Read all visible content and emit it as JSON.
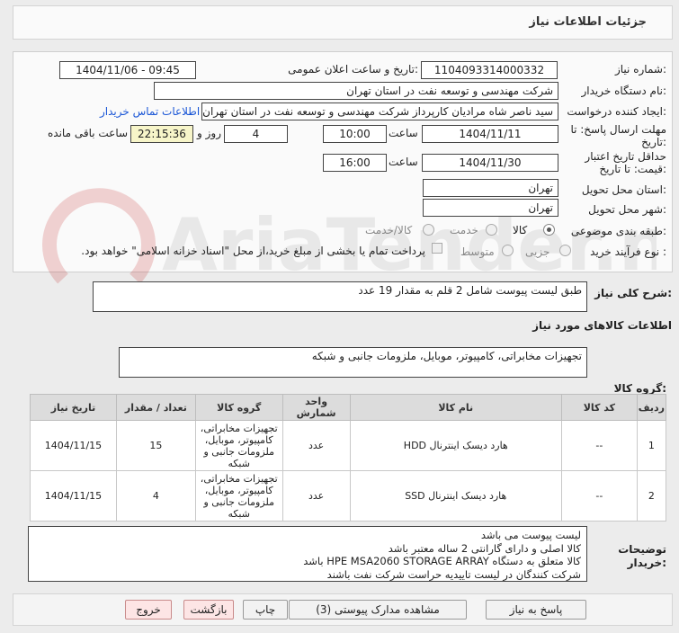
{
  "header": {
    "title": "جزئیات اطلاعات نیاز"
  },
  "form": {
    "need_number_label": "شماره نیاز:",
    "need_number": "1104093314000332",
    "announce_label": "تاریخ و ساعت اعلان عمومی:",
    "announce_value": "1404/11/06 - 09:45",
    "buyer_org_label": "نام دستگاه خریدار:",
    "buyer_org": "شرکت مهندسی و توسعه نفت در استان تهران",
    "creator_label": "ایجاد کننده درخواست:",
    "creator": "سید ناصر شاه مرادیان کارپرداز شرکت مهندسی و توسعه نفت در استان تهران",
    "contact_link": "اطلاعات تماس خریدار",
    "deadline_label_1": "مهلت ارسال پاسخ: تا",
    "deadline_label_2": "تاریخ:",
    "deadline_date": "1404/11/11",
    "time_label": "ساعت",
    "deadline_time": "10:00",
    "days_value": "4",
    "days_label": "روز و",
    "remaining_time": "22:15:36",
    "remaining_label": "ساعت باقی مانده",
    "validity_label_1": "حداقل تاریخ اعتبار",
    "validity_label_2": "قیمت: تا تاریخ:",
    "validity_date": "1404/11/30",
    "validity_time": "16:00",
    "province_label": "استان محل تحویل:",
    "province": "تهران",
    "city_label": "شهر محل تحویل:",
    "city": "تهران",
    "category_label": "طبقه بندی موضوعی:",
    "category_options": [
      "کالا",
      "خدمت",
      "کالا/خدمت"
    ],
    "category_selected": "کالا",
    "process_label": "نوع فرآیند خرید :",
    "process_options": [
      "جزیی",
      "متوسط"
    ],
    "process_note": "پرداخت تمام یا بخشی از مبلغ خرید،از محل \"اسناد خزانه اسلامی\" خواهد بود."
  },
  "summary": {
    "label": "شرح کلی نیاز:",
    "value": "طبق لیست پیوست شامل 2 قلم به مقدار 19 عدد"
  },
  "goods_section_title": "اطلاعات کالاهای مورد نیاز",
  "goods_group": {
    "label": "گروه کالا:",
    "value": "تجهیزات مخابراتی، کامپیوتر، موبایل، ملزومات جانبی و شبکه"
  },
  "table": {
    "headers": [
      "ردیف",
      "کد کالا",
      "نام کالا",
      "واحد شمارش",
      "گروه کالا",
      "تعداد / مقدار",
      "تاریخ نیاز"
    ],
    "rows": [
      [
        "1",
        "--",
        "هارد دیسک اینترنال HDD",
        "عدد",
        "تجهیزات مخابراتی، کامپیوتر، موبایل، ملزومات جانبی و شبکه",
        "15",
        "1404/11/15"
      ],
      [
        "2",
        "--",
        "هارد دیسک اینترنال SSD",
        "عدد",
        "تجهیزات مخابراتی، کامپیوتر، موبایل، ملزومات جانبی و شبکه",
        "4",
        "1404/11/15"
      ]
    ]
  },
  "buyer_notes": {
    "label_1": "توضیحات",
    "label_2": "خریدار:",
    "lines": [
      "لیست پیوست می باشد",
      "کالا اصلی و دارای گارانتی 2 ساله معتبر باشد",
      "کالا متعلق به دستگاه HPE MSA2060 STORAGE ARRAY باشد",
      "شرکت کنندگان در لیست تاییدیه حراست شرکت نفت باشند"
    ]
  },
  "buttons": {
    "reply": "پاسخ به نیاز",
    "attachments": "مشاهده مدارک پیوستی (3)",
    "print": "چاپ",
    "back": "بازگشت",
    "exit": "خروج"
  },
  "watermark": {
    "text": "AriaTender.neT"
  }
}
